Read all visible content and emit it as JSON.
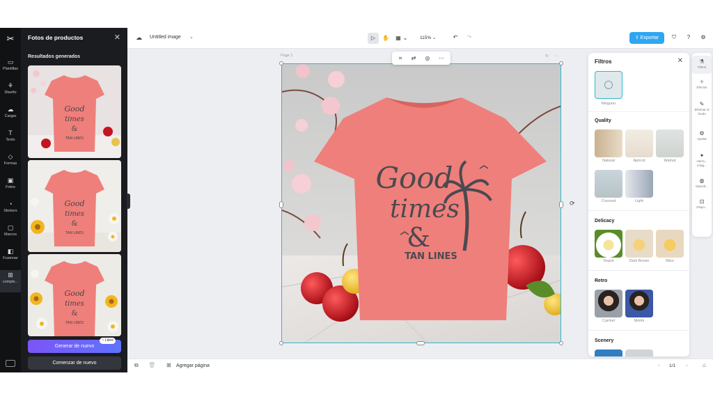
{
  "rail": {
    "logo": "✂",
    "items": [
      {
        "label": "Plantillas",
        "icon": "▭"
      },
      {
        "label": "Diseño",
        "icon": "⚘"
      },
      {
        "label": "Cargar",
        "icon": "☁"
      },
      {
        "label": "Texto",
        "icon": "T"
      },
      {
        "label": "Formas",
        "icon": "◇"
      },
      {
        "label": "Fotos",
        "icon": "▣"
      },
      {
        "label": "Stickers",
        "icon": "◔"
      },
      {
        "label": "Marcos",
        "icon": "▢"
      },
      {
        "label": "Fusionar",
        "icon": "◧"
      },
      {
        "label": "comple...",
        "icon": "⊞"
      }
    ]
  },
  "panel": {
    "title": "Fotos de productos",
    "subtitle": "Resultados generados",
    "generate_label": "Generar de nuevo",
    "badge": "Libre",
    "restart_label": "Comenzar de nuevo"
  },
  "topbar": {
    "doc_title": "Untitled image",
    "zoom": "115%",
    "export_label": "Exportar"
  },
  "canvas": {
    "page_label": "Page 1",
    "shirt_text_1": "Good",
    "shirt_text_2": "times",
    "shirt_text_3": "&",
    "shirt_text_4": "TAN LINES"
  },
  "filters": {
    "title": "Filtros",
    "none_label": "Ninguno",
    "sections": {
      "quality": "Quality",
      "delicacy": "Delicacy",
      "retro": "Retro",
      "scenery": "Scenery"
    },
    "quality_items": [
      "Natural",
      "Apricot",
      "Walnut",
      "Coconut",
      "Light"
    ],
    "delicacy_items": [
      "Snack",
      "Dark Brown",
      "Miso"
    ],
    "retro_items": [
      "Carmel",
      "Moimi"
    ]
  },
  "right_tools": [
    {
      "label": "Filtros",
      "icon": "⚗"
    },
    {
      "label": "Efectos",
      "icon": "✧"
    },
    {
      "label": "Eliminar el fondo",
      "icon": "✎"
    },
    {
      "label": "Ajustar",
      "icon": "⚙"
    },
    {
      "label": "Herra... imag...",
      "icon": "✦"
    },
    {
      "label": "Opacid...",
      "icon": "◍"
    },
    {
      "label": "Dispo...",
      "icon": "⊡"
    }
  ],
  "bottombar": {
    "add_page": "Agregar página",
    "page_count": "1/1"
  },
  "colors": {
    "accent": "#2fa6f2",
    "selection": "#31b6c9",
    "shirt": "#ef7f7b",
    "generate_gradient_start": "#7b55f5"
  }
}
